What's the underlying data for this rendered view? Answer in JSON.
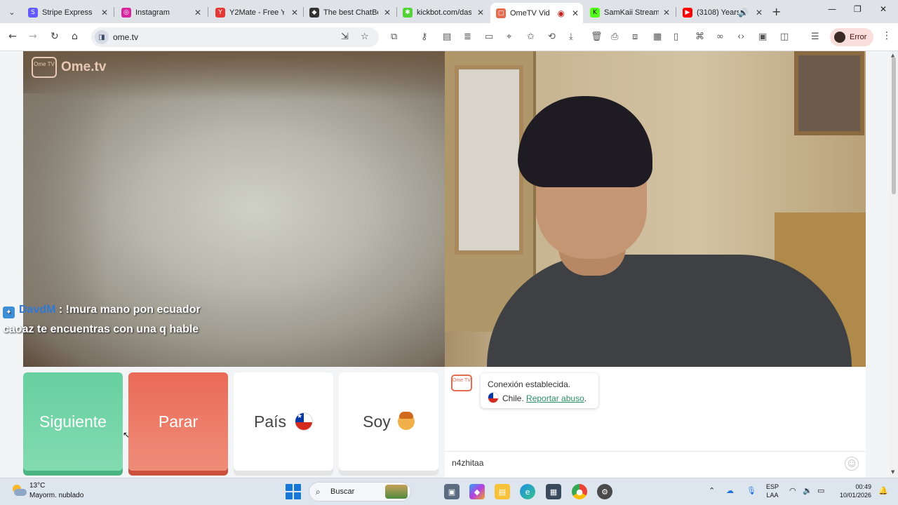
{
  "tabs": [
    {
      "label": "Stripe Express",
      "favicon": "stripe-icon",
      "color": "#635bff",
      "glyph": "S"
    },
    {
      "label": "Instagram",
      "favicon": "instagram-icon",
      "color": "#d6249f",
      "glyph": "◎"
    },
    {
      "label": "Y2Mate - Free Y",
      "favicon": "y2mate-icon",
      "color": "#e53935",
      "glyph": "Y"
    },
    {
      "label": "The best ChatBo",
      "favicon": "chatbot-icon",
      "color": "#333333",
      "glyph": "◆"
    },
    {
      "label": "kickbot.com/das",
      "favicon": "kickbot-icon",
      "color": "#53d337",
      "glyph": "✱"
    },
    {
      "label": "OmeTV Vide",
      "favicon": "ometv-icon",
      "color": "#e46c4f",
      "glyph": "▢",
      "active": true
    },
    {
      "label": "SamKaii Stream",
      "favicon": "kick-icon",
      "color": "#53fc18",
      "glyph": "K"
    },
    {
      "label": "(3108) Years",
      "favicon": "youtube-icon",
      "color": "#ff0000",
      "glyph": "▶"
    }
  ],
  "toolbar": {
    "url": "ome.tv",
    "profile_label": "Error"
  },
  "page": {
    "logo_text": "Ome.tv",
    "logo_tv": "Ome TV",
    "chat_overlay": {
      "user": "DavdM",
      "message_line1": ": !mura mano pon ecuador",
      "message_line2": "caoaz te encuentras con una q hable"
    },
    "buttons": {
      "next": "Siguiente",
      "stop": "Parar",
      "country": "País",
      "gender": "Soy"
    },
    "chat": {
      "status": "Conexión establecida.",
      "country": "Chile.",
      "report_link": "Reportar abuso",
      "input_value": "n4zhitaa"
    }
  },
  "taskbar": {
    "temperature": "13°C",
    "weather": "Mayorm. nublado",
    "search_placeholder": "Buscar",
    "lang_line1": "ESP",
    "lang_line2": "LAA",
    "time": "00:49",
    "date": "10/01/2026"
  },
  "colors": {
    "next_button": "#6fd4a6",
    "stop_button": "#ec7a66",
    "report_link": "#2a8f63"
  }
}
